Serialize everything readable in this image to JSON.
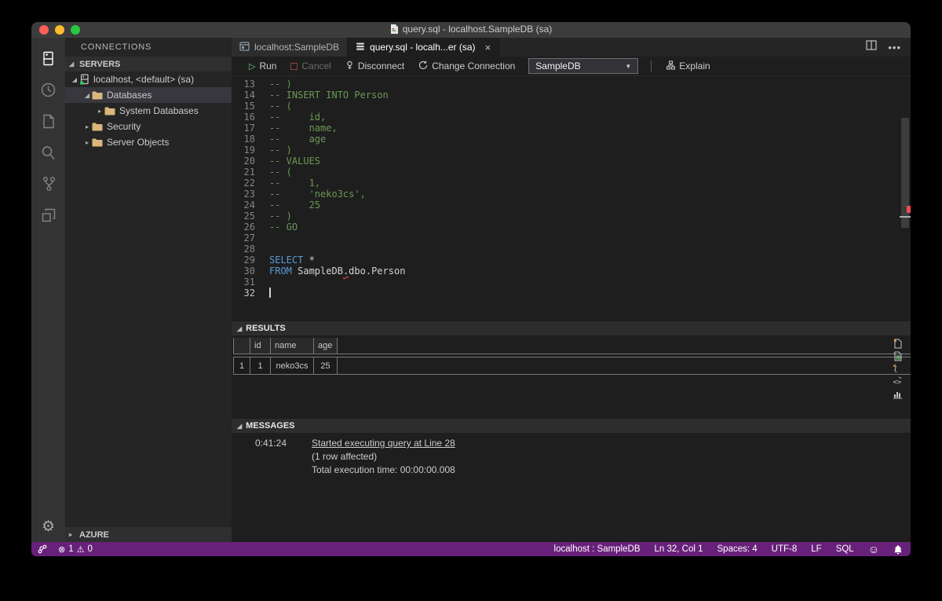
{
  "window": {
    "title": "query.sql - localhost.SampleDB (sa)"
  },
  "activity_bar": {
    "items": [
      "connections",
      "task-history",
      "notebooks",
      "search",
      "source-control",
      "extensions"
    ],
    "active": "connections",
    "settings": "manage"
  },
  "sidebar": {
    "title": "CONNECTIONS",
    "servers_section": "SERVERS",
    "azure_section": "AZURE",
    "tree": [
      {
        "label": "localhost, <default> (sa)",
        "level": 0,
        "expanded": true,
        "icon": "server",
        "selected": false
      },
      {
        "label": "Databases",
        "level": 1,
        "expanded": true,
        "icon": "folder",
        "selected": true
      },
      {
        "label": "System Databases",
        "level": 2,
        "expanded": false,
        "icon": "folder",
        "selected": false
      },
      {
        "label": "Security",
        "level": 1,
        "expanded": false,
        "icon": "folder",
        "selected": false
      },
      {
        "label": "Server Objects",
        "level": 1,
        "expanded": false,
        "icon": "folder",
        "selected": false
      }
    ]
  },
  "tabs": [
    {
      "label": "localhost:SampleDB",
      "active": false,
      "icon": "dashboard"
    },
    {
      "label": "query.sql - localh...er (sa)",
      "active": true,
      "icon": "file-lines",
      "close": "×"
    }
  ],
  "toolbar": {
    "run": "Run",
    "cancel": "Cancel",
    "disconnect": "Disconnect",
    "change_connection": "Change Connection",
    "database_dropdown": "SampleDB",
    "explain": "Explain"
  },
  "editor": {
    "lines": [
      {
        "n": "13",
        "seg": [
          [
            "-- )",
            "c"
          ]
        ]
      },
      {
        "n": "14",
        "seg": [
          [
            "-- INSERT INTO Person",
            "c"
          ]
        ]
      },
      {
        "n": "15",
        "seg": [
          [
            "-- (",
            "c"
          ]
        ]
      },
      {
        "n": "16",
        "seg": [
          [
            "--     id,",
            "c"
          ]
        ]
      },
      {
        "n": "17",
        "seg": [
          [
            "--     name,",
            "c"
          ]
        ]
      },
      {
        "n": "18",
        "seg": [
          [
            "--     age",
            "c"
          ]
        ]
      },
      {
        "n": "19",
        "seg": [
          [
            "-- )",
            "c"
          ]
        ]
      },
      {
        "n": "20",
        "seg": [
          [
            "-- VALUES",
            "c"
          ]
        ]
      },
      {
        "n": "21",
        "seg": [
          [
            "-- (",
            "c"
          ]
        ]
      },
      {
        "n": "22",
        "seg": [
          [
            "--     1,",
            "c"
          ]
        ]
      },
      {
        "n": "23",
        "seg": [
          [
            "--     'neko3cs',",
            "c"
          ]
        ]
      },
      {
        "n": "24",
        "seg": [
          [
            "--     25",
            "c"
          ]
        ]
      },
      {
        "n": "25",
        "seg": [
          [
            "-- )",
            "c"
          ]
        ]
      },
      {
        "n": "26",
        "seg": [
          [
            "-- GO",
            "c"
          ]
        ]
      },
      {
        "n": "27",
        "seg": []
      },
      {
        "n": "28",
        "seg": []
      },
      {
        "n": "29",
        "seg": [
          [
            "SELECT",
            "k"
          ],
          [
            " *",
            "p"
          ]
        ]
      },
      {
        "n": "30",
        "seg": [
          [
            "FROM",
            "k"
          ],
          [
            " SampleDB",
            "p"
          ],
          [
            ".",
            "e"
          ],
          [
            "dbo.Person",
            "p"
          ]
        ]
      },
      {
        "n": "31",
        "seg": []
      },
      {
        "n": "32",
        "seg": [],
        "cursor": true,
        "active": true
      }
    ]
  },
  "results": {
    "header": "RESULTS",
    "columns": [
      "id",
      "name",
      "age"
    ],
    "rows": [
      {
        "num": "1",
        "cells": [
          "1",
          "neko3cs",
          "25"
        ]
      }
    ],
    "export_icons": [
      "save-as-csv",
      "save-as-excel",
      "save-as-json",
      "save-as-xml",
      "show-chart"
    ]
  },
  "messages": {
    "header": "MESSAGES",
    "items": [
      {
        "time": "0:41:24",
        "text": "Started executing query at Line 28",
        "link": true
      },
      {
        "time": "",
        "text": "(1 row affected)",
        "link": false
      },
      {
        "time": "",
        "text": "Total execution time: 00:00:00.008",
        "link": false
      }
    ]
  },
  "status_bar": {
    "errors": "1",
    "warnings": "0",
    "connection": "localhost : SampleDB",
    "cursor_position": "Ln 32, Col 1",
    "indentation": "Spaces: 4",
    "encoding": "UTF-8",
    "eol": "LF",
    "language": "SQL"
  },
  "colors": {
    "statusbar": "#68217a",
    "comment_green": "#6a9955",
    "keyword_blue": "#569cd6",
    "folder_tan": "#dcb67a",
    "run_green": "#73c991",
    "error_red": "#f14c4c",
    "server_online_green": "#37be68"
  }
}
